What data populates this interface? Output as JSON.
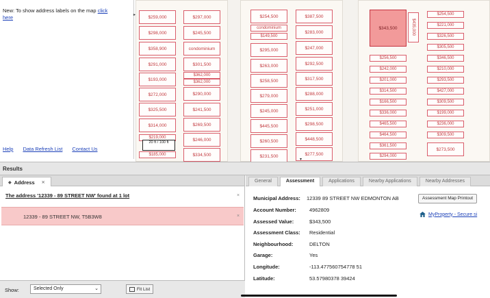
{
  "left_panel": {
    "tip_text": "New: To show address labels on the map",
    "tip_link": "click here",
    "links": [
      "Help",
      "Data Refresh List",
      "Contact Us"
    ]
  },
  "map": {
    "blocks": [
      {
        "columns": [
          [
            "$259,000",
            "$298,000",
            "$358,900",
            "$291,000",
            "$193,000",
            "$272,000",
            "$325,500",
            "$314,000",
            "$219,000",
            "$185,000"
          ],
          [
            "$297,000",
            "$245,500",
            "condominium",
            "$301,500",
            "$362,000",
            "$362,000",
            "$290,000",
            "$241,500",
            "$269,500",
            "$246,000",
            "$334,500"
          ]
        ]
      },
      {
        "columns": [
          [
            "$254,500",
            "condominium",
            "$149,500",
            "$295,000",
            "$263,000",
            "$258,500",
            "$279,000",
            "$245,000",
            "$445,500",
            "$260,500",
            "$231,500"
          ],
          [
            "$387,500",
            "$283,000",
            "$247,000",
            "$292,500",
            "$317,500",
            "$288,000",
            "$251,000",
            "$298,500",
            "$448,500",
            "$277,500"
          ]
        ]
      },
      {
        "columns": [
          [
            "$343,500",
            "$435,000",
            "$256,500",
            "$242,000",
            "$201,000",
            "$314,500",
            "$166,500",
            "$336,000",
            "$465,500",
            "$464,500",
            "$361,500",
            "$294,000"
          ],
          [
            "$254,500",
            "$221,000",
            "$326,500",
            "$305,500",
            "$346,500",
            "$210,000",
            "$293,500",
            "$427,000",
            "$309,500",
            "$199,000",
            "$236,000",
            "$309,500",
            "$273,500"
          ]
        ]
      }
    ],
    "measure_text": "20 ft / 100 ft"
  },
  "results": {
    "title": "Results",
    "address_tab": "Address",
    "found_text": "The address '12339 - 89 STREET NW' found at 1 lot",
    "address_row": "12339 - 89 STREET NW, T5B3W8",
    "show_label": "Show:",
    "show_value": "Selected Only",
    "fit_button": "Fit List"
  },
  "details": {
    "tabs": [
      "General",
      "Assessment",
      "Applications",
      "Nearby Applications",
      "Nearby Addresses"
    ],
    "active_tab": "Assessment",
    "fields": [
      {
        "label": "Municipal Address:",
        "value": "12339 89 STREET NW EDMONTON AB"
      },
      {
        "label": "Account Number:",
        "value": "4962809"
      },
      {
        "label": "Assessed Value:",
        "value": "$343,500"
      },
      {
        "label": "Assessment Class:",
        "value": "Residential"
      },
      {
        "label": "Neighbourhood:",
        "value": "DELTON"
      },
      {
        "label": "Garage:",
        "value": "Yes"
      },
      {
        "label": "Longitude:",
        "value": "-113.477560754778 51"
      },
      {
        "label": "Latitude:",
        "value": "53.57980378 39424"
      }
    ],
    "printout_button": "Assessment Map Printout",
    "myproperty_link": "MyProperty - Secure si"
  },
  "colors": {
    "lot_border": "#d95c6a",
    "lot_text": "#c2393e",
    "selected_lot": "#f29a9a",
    "selected_row": "#f8c9c9",
    "link": "#1a3fb8"
  }
}
